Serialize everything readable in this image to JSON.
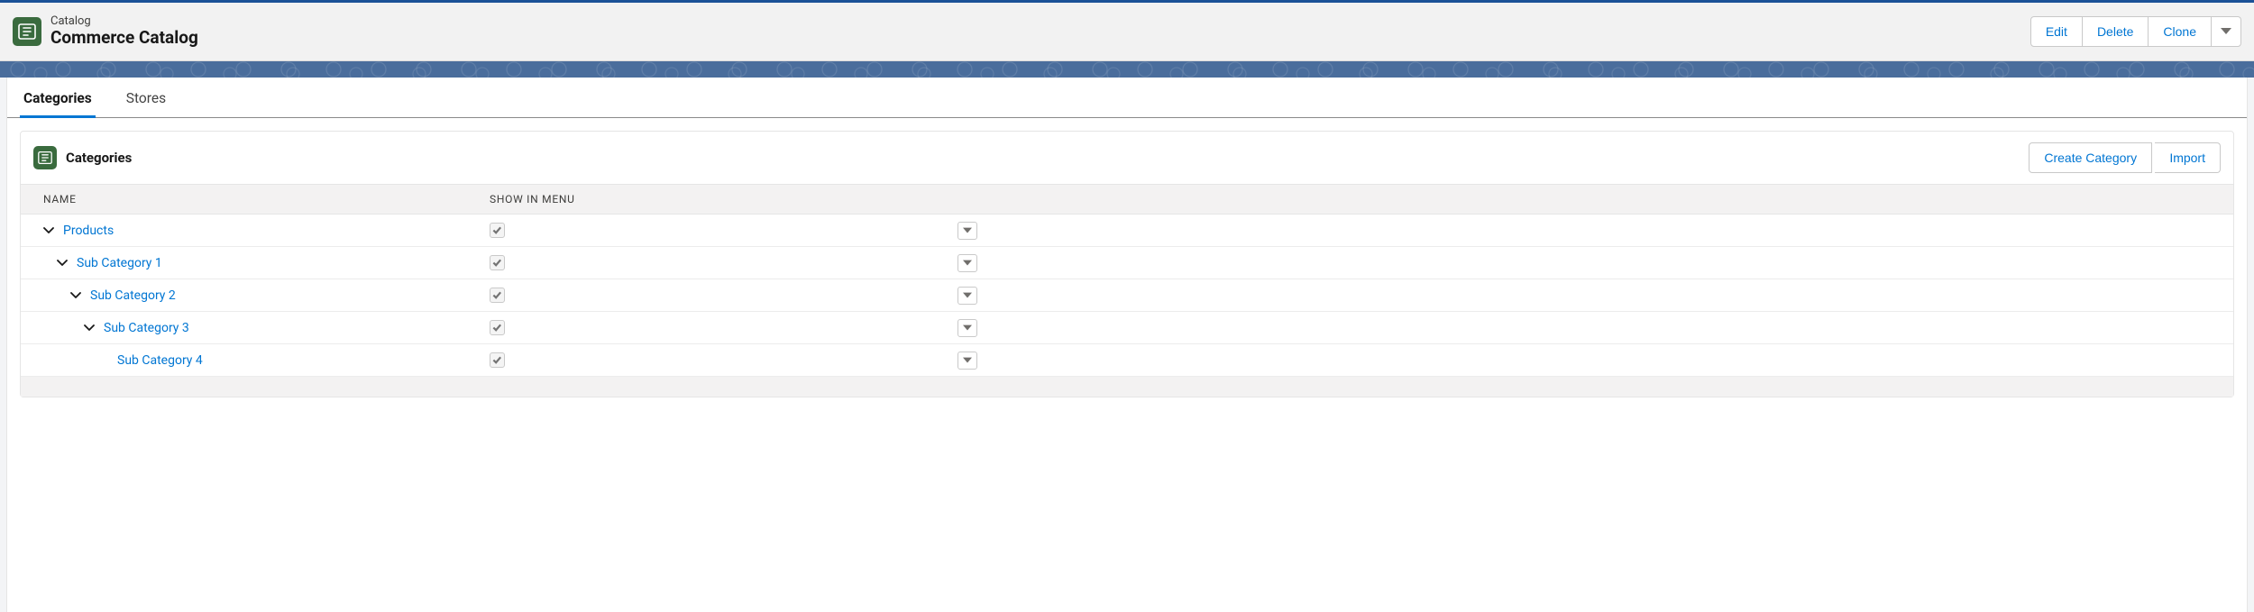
{
  "header": {
    "eyebrow": "Catalog",
    "title": "Commerce Catalog",
    "actions": {
      "edit": "Edit",
      "delete": "Delete",
      "clone": "Clone"
    }
  },
  "tabs": [
    {
      "label": "Categories",
      "active": true
    },
    {
      "label": "Stores",
      "active": false
    }
  ],
  "panel": {
    "title": "Categories",
    "actions": {
      "create": "Create Category",
      "import": "Import"
    },
    "columns": {
      "name": "Name",
      "show_in_menu": "Show in Menu"
    },
    "rows": [
      {
        "name": "Products",
        "indent": 0,
        "expandable": true,
        "show_in_menu": true
      },
      {
        "name": "Sub Category 1",
        "indent": 1,
        "expandable": true,
        "show_in_menu": true
      },
      {
        "name": "Sub Category 2",
        "indent": 2,
        "expandable": true,
        "show_in_menu": true
      },
      {
        "name": "Sub Category 3",
        "indent": 3,
        "expandable": true,
        "show_in_menu": true
      },
      {
        "name": "Sub Category 4",
        "indent": 4,
        "expandable": false,
        "show_in_menu": true
      }
    ]
  }
}
